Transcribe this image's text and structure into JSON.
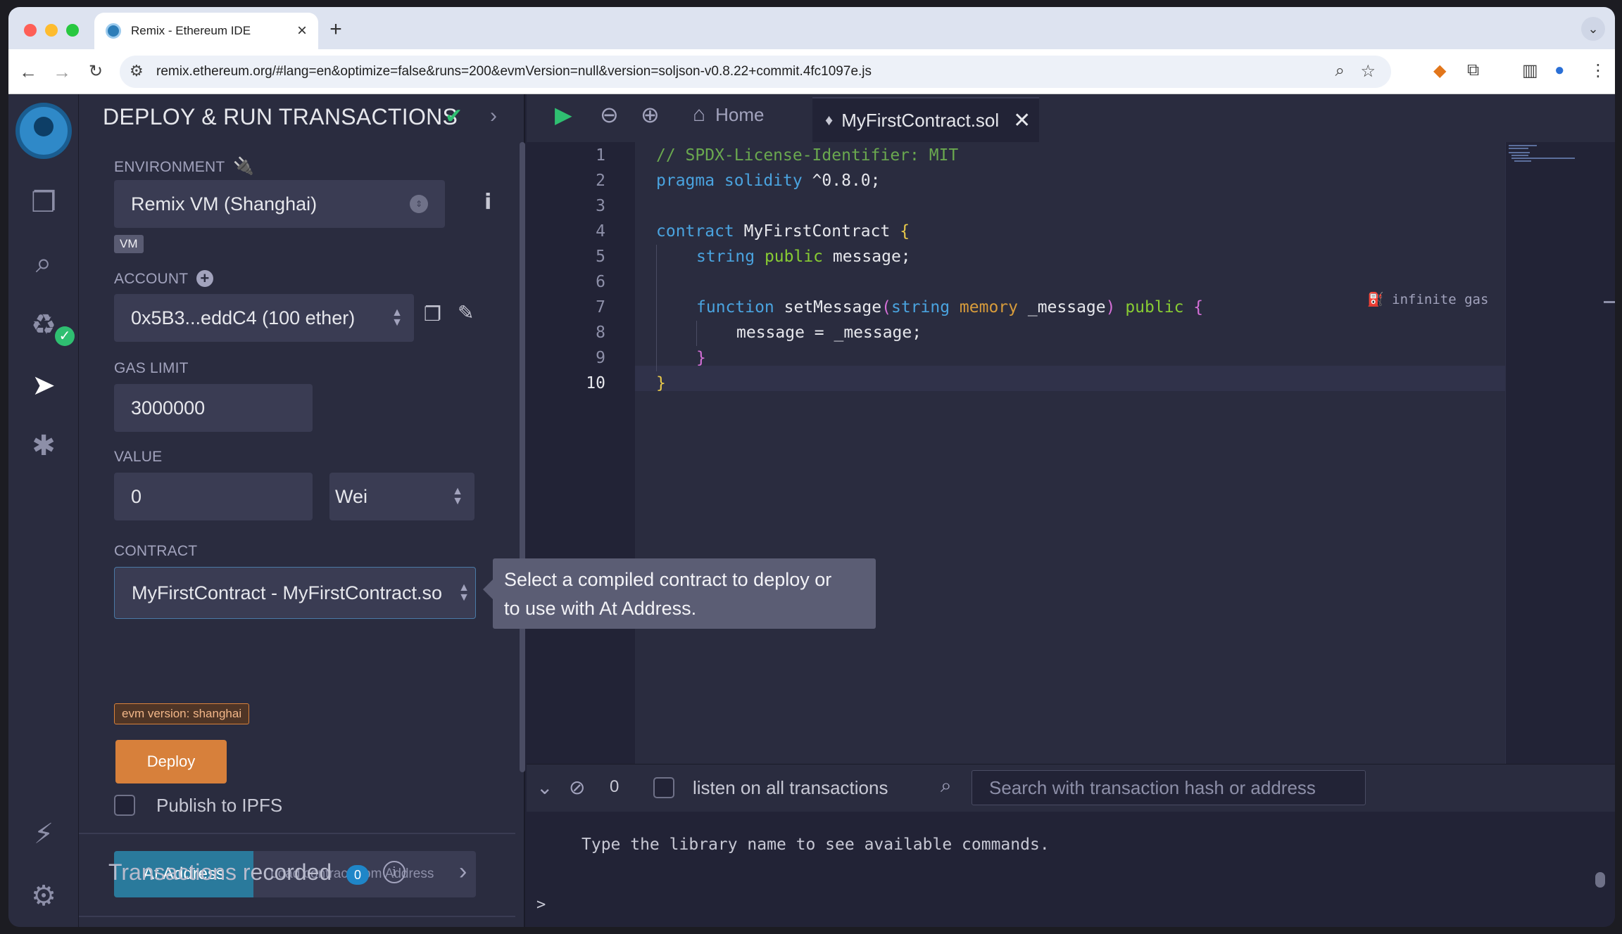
{
  "browser": {
    "tab_title": "Remix - Ethereum IDE",
    "url": "remix.ethereum.org/#lang=en&optimize=false&runs=200&evmVersion=null&version=soljson-v0.8.22+commit.4fc1097e.js"
  },
  "colors": {
    "accent_orange": "#d7803b",
    "accent_blue": "#2a7a9c",
    "success_green": "#2fbf71",
    "panel_bg": "#2a2c3f"
  },
  "icon_panel": {
    "items": [
      "remix-logo",
      "file-explorer-icon",
      "search-icon",
      "solidity-compiler-icon",
      "deploy-run-icon",
      "debugger-icon",
      "plugin-manager-icon",
      "settings-icon"
    ]
  },
  "side_panel": {
    "title": "DEPLOY & RUN TRANSACTIONS",
    "environment_label": "ENVIRONMENT",
    "environment_value": "Remix VM (Shanghai)",
    "vm_badge": "VM",
    "account_label": "ACCOUNT",
    "account_value": "0x5B3...eddC4 (100 ether)",
    "gas_limit_label": "GAS LIMIT",
    "gas_limit_value": "3000000",
    "value_label": "VALUE",
    "value_amount": "0",
    "value_unit": "Wei",
    "contract_label": "CONTRACT",
    "contract_value": "MyFirstContract - MyFirstContract.so",
    "evm_badge": "evm version: shanghai",
    "deploy_label": "Deploy",
    "publish_ipfs_label": "Publish to IPFS",
    "at_address_label": "At Address",
    "load_contract_placeholder": "Load contract from Address",
    "transactions_recorded_label": "Transactions recorded",
    "transactions_recorded_count": "0"
  },
  "tooltip": {
    "text_line1": "Select a compiled contract to deploy or",
    "text_line2": "to use with At Address."
  },
  "editor": {
    "home_tab_label": "Home",
    "file_tab_label": "MyFirstContract.sol",
    "line_numbers": [
      "1",
      "2",
      "3",
      "4",
      "5",
      "6",
      "7",
      "8",
      "9",
      "10"
    ],
    "code": {
      "l1_comment": "// SPDX-License-Identifier: MIT",
      "l2_kw": "pragma solidity",
      "l2_rest": " ^0.8.0;",
      "l4_kw": "contract",
      "l4_name": " MyFirstContract ",
      "l4_brace": "{",
      "l5_type": "string",
      "l5_vis": " public",
      "l5_rest": " message;",
      "l7_kw": "function",
      "l7_name": " setMessage",
      "l7_paren_open": "(",
      "l7_type": "string",
      "l7_mem": " memory",
      "l7_param": " _message",
      "l7_paren_close": ")",
      "l7_vis": " public ",
      "l7_brace": "{",
      "l8_code": "message = _message;",
      "l9_brace": "}",
      "l10_brace": "}"
    },
    "gas_hint": "infinite gas"
  },
  "terminal": {
    "tx_count": "0",
    "listen_label": "listen on all transactions",
    "search_placeholder": "Search with transaction hash or address",
    "message": "Type the library name to see available commands.",
    "prompt": ">"
  }
}
